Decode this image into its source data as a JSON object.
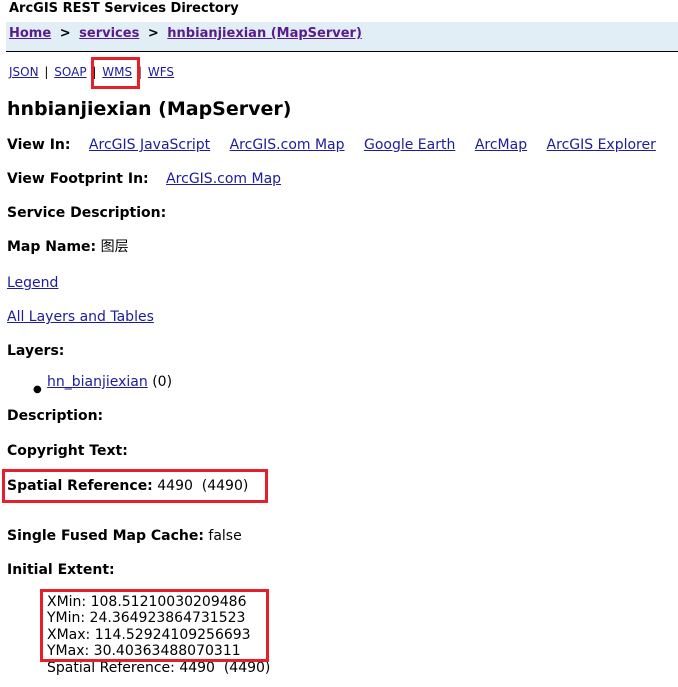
{
  "header": {
    "title": "ArcGIS REST Services Directory"
  },
  "breadcrumb": {
    "home": "Home",
    "sep1": ">",
    "services": "services",
    "sep2": ">",
    "current": "hnbianjiexian (MapServer)"
  },
  "formats": {
    "json": "JSON",
    "pipe1": "|",
    "soap": "SOAP",
    "pipe2": "|",
    "wms": "WMS",
    "pipe3": "|",
    "wfs": "WFS"
  },
  "page_title": "hnbianjiexian (MapServer)",
  "view_in": {
    "label": "View In:",
    "links": [
      "ArcGIS JavaScript",
      "ArcGIS.com Map",
      "Google Earth",
      "ArcMap",
      "ArcGIS Explorer"
    ]
  },
  "view_footprint": {
    "label": "View Footprint In:",
    "link": "ArcGIS.com Map"
  },
  "service_description": {
    "label": "Service Description:"
  },
  "map_name": {
    "label": "Map Name:",
    "value": "图层"
  },
  "legend_link": "Legend",
  "all_layers_link": "All Layers and Tables",
  "layers": {
    "label": "Layers:",
    "items": [
      {
        "name": "hn_bianjiexian",
        "id": "(0)"
      }
    ]
  },
  "description": {
    "label": "Description:"
  },
  "copyright": {
    "label": "Copyright Text:"
  },
  "spatial_reference": {
    "label": "Spatial Reference:",
    "value": "4490  (4490)"
  },
  "single_fused": {
    "label": "Single Fused Map Cache:",
    "value": "false"
  },
  "initial_extent": {
    "label": "Initial Extent:",
    "xmin": "XMin: 108.51210030209486",
    "ymin": "YMin: 24.364923864731523",
    "xmax": "XMax: 114.52924109256693",
    "ymax": "YMax: 30.40363488070311",
    "spatial_ref": "Spatial Reference: 4490  (4490)"
  },
  "colors": {
    "highlight": "#e51f2c",
    "link": "#1c1c9c",
    "visited": "#5a1b8c",
    "breadcrumb_bg": "#e2eef6"
  }
}
